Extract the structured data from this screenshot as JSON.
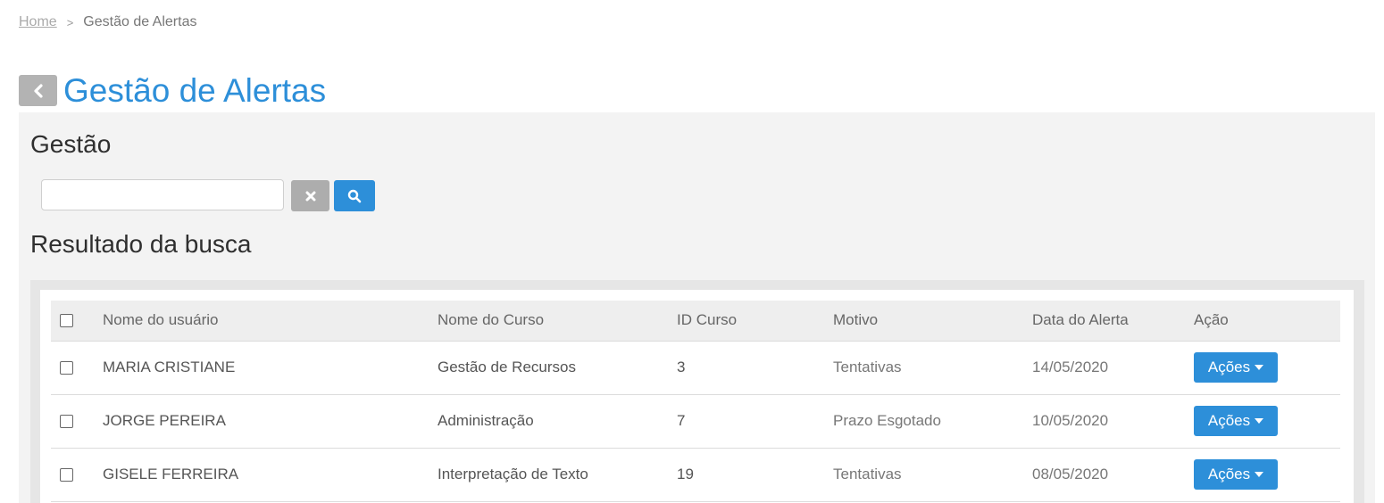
{
  "breadcrumb": {
    "home": "Home",
    "separator": ">",
    "current": "Gestão de Alertas"
  },
  "header": {
    "title": "Gestão de Alertas",
    "back_icon": "chevron-left-icon"
  },
  "search_section": {
    "title": "Gestão",
    "input_value": "",
    "clear_icon": "times-icon",
    "search_icon": "search-icon"
  },
  "results": {
    "title": "Resultado da busca",
    "columns": [
      "Nome do usuário",
      "Nome do Curso",
      "ID Curso",
      "Motivo",
      "Data do Alerta",
      "Ação"
    ],
    "rows": [
      {
        "user": "MARIA CRISTIANE",
        "course": "Gestão de Recursos",
        "course_id": "3",
        "reason": "Tentativas",
        "date": "14/05/2020",
        "action": "Ações"
      },
      {
        "user": "JORGE PEREIRA",
        "course": "Administração",
        "course_id": "7",
        "reason": "Prazo Esgotado",
        "date": "10/05/2020",
        "action": "Ações"
      },
      {
        "user": "GISELE FERREIRA",
        "course": "Interpretação de Texto",
        "course_id": "19",
        "reason": "Tentativas",
        "date": "08/05/2020",
        "action": "Ações"
      }
    ]
  },
  "colors": {
    "accent": "#2d8fd9",
    "panel_bg": "#f3f3f3",
    "button_gray": "#adadad"
  }
}
